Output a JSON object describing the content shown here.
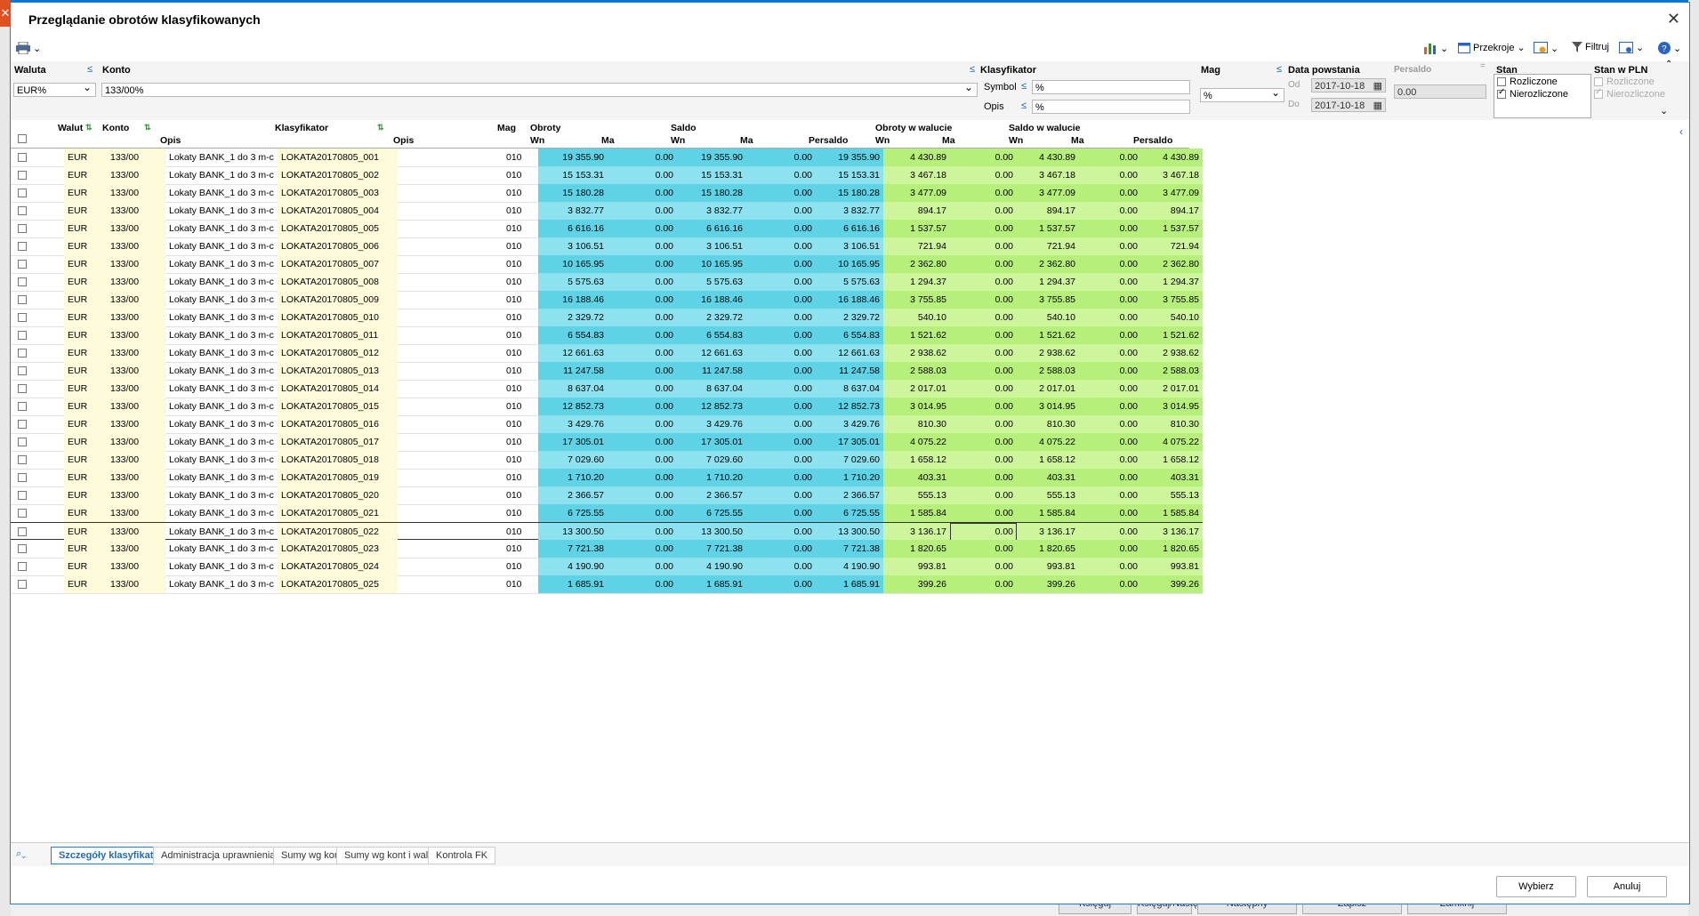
{
  "window": {
    "title": "Przeglądanie obrotów klasyfikowanych",
    "close": "✕"
  },
  "toolbar": {
    "przekroje": "Przekroje",
    "filtruj": "Filtruj"
  },
  "filters": {
    "waluta_label": "Waluta",
    "waluta_value": "EUR%",
    "konto_label": "Konto",
    "konto_value": "133/00%",
    "klasyfikator_label": "Klasyfikator",
    "symbol_label": "Symbol",
    "symbol_value": "%",
    "opis_label": "Opis",
    "opis_value": "%",
    "mag_label": "Mag",
    "mag_value": "%",
    "data_label": "Data powstania",
    "od_label": "Od",
    "od_value": "2017-10-18",
    "do_label": "Do",
    "do_value": "2017-10-18",
    "persaldo_label": "Persaldo",
    "persaldo_value": "0.00",
    "stan_label": "Stan",
    "rozliczone": "Rozliczone",
    "nierozliczone": "Nierozliczone",
    "stanpln_label": "Stan w PLN",
    "pln_rozliczone": "Rozliczone",
    "pln_nierozliczone": "Nierozliczone",
    "le": "≤"
  },
  "headers": {
    "walut": "Walut",
    "konto": "Konto",
    "opis1": "Opis",
    "klasyfikator": "Klasyfikator",
    "opis2": "Opis",
    "mag": "Mag",
    "obroty": "Obroty",
    "saldo": "Saldo",
    "obroty_w": "Obroty w walucie",
    "saldo_w": "Saldo w walucie",
    "wn": "Wn",
    "ma": "Ma",
    "persaldo": "Persaldo"
  },
  "rows": [
    {
      "w": "EUR",
      "k": "133/00",
      "o": "Lokaty BANK_1 do 3 m-c",
      "s": "LOKATA20170805_001",
      "m": "010",
      "ow": "19 355.90",
      "om": "0.00",
      "sw": "19 355.90",
      "sm": "0.00",
      "sp": "19 355.90",
      "vw": "4 430.89",
      "vm": "0.00",
      "xw": "4 430.89",
      "xm": "0.00",
      "xp": "4 430.89"
    },
    {
      "w": "EUR",
      "k": "133/00",
      "o": "Lokaty BANK_1 do 3 m-c",
      "s": "LOKATA20170805_002",
      "m": "010",
      "ow": "15 153.31",
      "om": "0.00",
      "sw": "15 153.31",
      "sm": "0.00",
      "sp": "15 153.31",
      "vw": "3 467.18",
      "vm": "0.00",
      "xw": "3 467.18",
      "xm": "0.00",
      "xp": "3 467.18"
    },
    {
      "w": "EUR",
      "k": "133/00",
      "o": "Lokaty BANK_1 do 3 m-c",
      "s": "LOKATA20170805_003",
      "m": "010",
      "ow": "15 180.28",
      "om": "0.00",
      "sw": "15 180.28",
      "sm": "0.00",
      "sp": "15 180.28",
      "vw": "3 477.09",
      "vm": "0.00",
      "xw": "3 477.09",
      "xm": "0.00",
      "xp": "3 477.09"
    },
    {
      "w": "EUR",
      "k": "133/00",
      "o": "Lokaty BANK_1 do 3 m-c",
      "s": "LOKATA20170805_004",
      "m": "010",
      "ow": "3 832.77",
      "om": "0.00",
      "sw": "3 832.77",
      "sm": "0.00",
      "sp": "3 832.77",
      "vw": "894.17",
      "vm": "0.00",
      "xw": "894.17",
      "xm": "0.00",
      "xp": "894.17"
    },
    {
      "w": "EUR",
      "k": "133/00",
      "o": "Lokaty BANK_1 do 3 m-c",
      "s": "LOKATA20170805_005",
      "m": "010",
      "ow": "6 616.16",
      "om": "0.00",
      "sw": "6 616.16",
      "sm": "0.00",
      "sp": "6 616.16",
      "vw": "1 537.57",
      "vm": "0.00",
      "xw": "1 537.57",
      "xm": "0.00",
      "xp": "1 537.57"
    },
    {
      "w": "EUR",
      "k": "133/00",
      "o": "Lokaty BANK_1 do 3 m-c",
      "s": "LOKATA20170805_006",
      "m": "010",
      "ow": "3 106.51",
      "om": "0.00",
      "sw": "3 106.51",
      "sm": "0.00",
      "sp": "3 106.51",
      "vw": "721.94",
      "vm": "0.00",
      "xw": "721.94",
      "xm": "0.00",
      "xp": "721.94"
    },
    {
      "w": "EUR",
      "k": "133/00",
      "o": "Lokaty BANK_1 do 3 m-c",
      "s": "LOKATA20170805_007",
      "m": "010",
      "ow": "10 165.95",
      "om": "0.00",
      "sw": "10 165.95",
      "sm": "0.00",
      "sp": "10 165.95",
      "vw": "2 362.80",
      "vm": "0.00",
      "xw": "2 362.80",
      "xm": "0.00",
      "xp": "2 362.80"
    },
    {
      "w": "EUR",
      "k": "133/00",
      "o": "Lokaty BANK_1 do 3 m-c",
      "s": "LOKATA20170805_008",
      "m": "010",
      "ow": "5 575.63",
      "om": "0.00",
      "sw": "5 575.63",
      "sm": "0.00",
      "sp": "5 575.63",
      "vw": "1 294.37",
      "vm": "0.00",
      "xw": "1 294.37",
      "xm": "0.00",
      "xp": "1 294.37"
    },
    {
      "w": "EUR",
      "k": "133/00",
      "o": "Lokaty BANK_1 do 3 m-c",
      "s": "LOKATA20170805_009",
      "m": "010",
      "ow": "16 188.46",
      "om": "0.00",
      "sw": "16 188.46",
      "sm": "0.00",
      "sp": "16 188.46",
      "vw": "3 755.85",
      "vm": "0.00",
      "xw": "3 755.85",
      "xm": "0.00",
      "xp": "3 755.85"
    },
    {
      "w": "EUR",
      "k": "133/00",
      "o": "Lokaty BANK_1 do 3 m-c",
      "s": "LOKATA20170805_010",
      "m": "010",
      "ow": "2 329.72",
      "om": "0.00",
      "sw": "2 329.72",
      "sm": "0.00",
      "sp": "2 329.72",
      "vw": "540.10",
      "vm": "0.00",
      "xw": "540.10",
      "xm": "0.00",
      "xp": "540.10"
    },
    {
      "w": "EUR",
      "k": "133/00",
      "o": "Lokaty BANK_1 do 3 m-c",
      "s": "LOKATA20170805_011",
      "m": "010",
      "ow": "6 554.83",
      "om": "0.00",
      "sw": "6 554.83",
      "sm": "0.00",
      "sp": "6 554.83",
      "vw": "1 521.62",
      "vm": "0.00",
      "xw": "1 521.62",
      "xm": "0.00",
      "xp": "1 521.62"
    },
    {
      "w": "EUR",
      "k": "133/00",
      "o": "Lokaty BANK_1 do 3 m-c",
      "s": "LOKATA20170805_012",
      "m": "010",
      "ow": "12 661.63",
      "om": "0.00",
      "sw": "12 661.63",
      "sm": "0.00",
      "sp": "12 661.63",
      "vw": "2 938.62",
      "vm": "0.00",
      "xw": "2 938.62",
      "xm": "0.00",
      "xp": "2 938.62"
    },
    {
      "w": "EUR",
      "k": "133/00",
      "o": "Lokaty BANK_1 do 3 m-c",
      "s": "LOKATA20170805_013",
      "m": "010",
      "ow": "11 247.58",
      "om": "0.00",
      "sw": "11 247.58",
      "sm": "0.00",
      "sp": "11 247.58",
      "vw": "2 588.03",
      "vm": "0.00",
      "xw": "2 588.03",
      "xm": "0.00",
      "xp": "2 588.03"
    },
    {
      "w": "EUR",
      "k": "133/00",
      "o": "Lokaty BANK_1 do 3 m-c",
      "s": "LOKATA20170805_014",
      "m": "010",
      "ow": "8 637.04",
      "om": "0.00",
      "sw": "8 637.04",
      "sm": "0.00",
      "sp": "8 637.04",
      "vw": "2 017.01",
      "vm": "0.00",
      "xw": "2 017.01",
      "xm": "0.00",
      "xp": "2 017.01"
    },
    {
      "w": "EUR",
      "k": "133/00",
      "o": "Lokaty BANK_1 do 3 m-c",
      "s": "LOKATA20170805_015",
      "m": "010",
      "ow": "12 852.73",
      "om": "0.00",
      "sw": "12 852.73",
      "sm": "0.00",
      "sp": "12 852.73",
      "vw": "3 014.95",
      "vm": "0.00",
      "xw": "3 014.95",
      "xm": "0.00",
      "xp": "3 014.95"
    },
    {
      "w": "EUR",
      "k": "133/00",
      "o": "Lokaty BANK_1 do 3 m-c",
      "s": "LOKATA20170805_016",
      "m": "010",
      "ow": "3 429.76",
      "om": "0.00",
      "sw": "3 429.76",
      "sm": "0.00",
      "sp": "3 429.76",
      "vw": "810.30",
      "vm": "0.00",
      "xw": "810.30",
      "xm": "0.00",
      "xp": "810.30"
    },
    {
      "w": "EUR",
      "k": "133/00",
      "o": "Lokaty BANK_1 do 3 m-c",
      "s": "LOKATA20170805_017",
      "m": "010",
      "ow": "17 305.01",
      "om": "0.00",
      "sw": "17 305.01",
      "sm": "0.00",
      "sp": "17 305.01",
      "vw": "4 075.22",
      "vm": "0.00",
      "xw": "4 075.22",
      "xm": "0.00",
      "xp": "4 075.22"
    },
    {
      "w": "EUR",
      "k": "133/00",
      "o": "Lokaty BANK_1 do 3 m-c",
      "s": "LOKATA20170805_018",
      "m": "010",
      "ow": "7 029.60",
      "om": "0.00",
      "sw": "7 029.60",
      "sm": "0.00",
      "sp": "7 029.60",
      "vw": "1 658.12",
      "vm": "0.00",
      "xw": "1 658.12",
      "xm": "0.00",
      "xp": "1 658.12"
    },
    {
      "w": "EUR",
      "k": "133/00",
      "o": "Lokaty BANK_1 do 3 m-c",
      "s": "LOKATA20170805_019",
      "m": "010",
      "ow": "1 710.20",
      "om": "0.00",
      "sw": "1 710.20",
      "sm": "0.00",
      "sp": "1 710.20",
      "vw": "403.31",
      "vm": "0.00",
      "xw": "403.31",
      "xm": "0.00",
      "xp": "403.31"
    },
    {
      "w": "EUR",
      "k": "133/00",
      "o": "Lokaty BANK_1 do 3 m-c",
      "s": "LOKATA20170805_020",
      "m": "010",
      "ow": "2 366.57",
      "om": "0.00",
      "sw": "2 366.57",
      "sm": "0.00",
      "sp": "2 366.57",
      "vw": "555.13",
      "vm": "0.00",
      "xw": "555.13",
      "xm": "0.00",
      "xp": "555.13"
    },
    {
      "w": "EUR",
      "k": "133/00",
      "o": "Lokaty BANK_1 do 3 m-c",
      "s": "LOKATA20170805_021",
      "m": "010",
      "ow": "6 725.55",
      "om": "0.00",
      "sw": "6 725.55",
      "sm": "0.00",
      "sp": "6 725.55",
      "vw": "1 585.84",
      "vm": "0.00",
      "xw": "1 585.84",
      "xm": "0.00",
      "xp": "1 585.84"
    },
    {
      "w": "EUR",
      "k": "133/00",
      "o": "Lokaty BANK_1 do 3 m-c",
      "s": "LOKATA20170805_022",
      "m": "010",
      "ow": "13 300.50",
      "om": "0.00",
      "sw": "13 300.50",
      "sm": "0.00",
      "sp": "13 300.50",
      "vw": "3 136.17",
      "vm": "0.00",
      "xw": "3 136.17",
      "xm": "0.00",
      "xp": "3 136.17"
    },
    {
      "w": "EUR",
      "k": "133/00",
      "o": "Lokaty BANK_1 do 3 m-c",
      "s": "LOKATA20170805_023",
      "m": "010",
      "ow": "7 721.38",
      "om": "0.00",
      "sw": "7 721.38",
      "sm": "0.00",
      "sp": "7 721.38",
      "vw": "1 820.65",
      "vm": "0.00",
      "xw": "1 820.65",
      "xm": "0.00",
      "xp": "1 820.65"
    },
    {
      "w": "EUR",
      "k": "133/00",
      "o": "Lokaty BANK_1 do 3 m-c",
      "s": "LOKATA20170805_024",
      "m": "010",
      "ow": "4 190.90",
      "om": "0.00",
      "sw": "4 190.90",
      "sm": "0.00",
      "sp": "4 190.90",
      "vw": "993.81",
      "vm": "0.00",
      "xw": "993.81",
      "xm": "0.00",
      "xp": "993.81"
    },
    {
      "w": "EUR",
      "k": "133/00",
      "o": "Lokaty BANK_1 do 3 m-c",
      "s": "LOKATA20170805_025",
      "m": "010",
      "ow": "1 685.91",
      "om": "0.00",
      "sw": "1 685.91",
      "sm": "0.00",
      "sp": "1 685.91",
      "vw": "399.26",
      "vm": "0.00",
      "xw": "399.26",
      "xm": "0.00",
      "xp": "399.26"
    }
  ],
  "selected_row_index": 21,
  "tabs": [
    "Szczegóły klasyfikatorów",
    "Administracja uprawnieniami",
    "Sumy wg kont",
    "Sumy wg kont i walut",
    "Kontrola FK"
  ],
  "buttons": {
    "wybierz": "Wybierz",
    "anuluj": "Anuluj"
  },
  "background_buttons": [
    "Księguj",
    "Księguj/Następny",
    "Następny",
    "Zapisz",
    "Zamknij"
  ],
  "colors": {
    "accent": "#1e7fd8",
    "cyan": "#5fd3e6",
    "green": "#b6f07a",
    "yellow": "#fdfbd9"
  }
}
